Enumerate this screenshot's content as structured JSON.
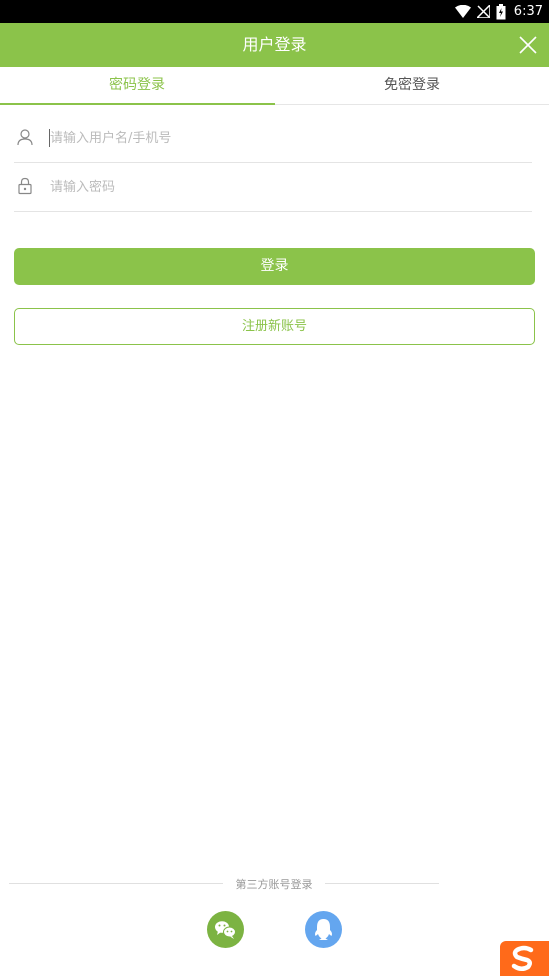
{
  "status_bar": {
    "time": "6:37"
  },
  "header": {
    "title": "用户登录"
  },
  "tabs": [
    {
      "label": "密码登录",
      "active": true
    },
    {
      "label": "免密登录",
      "active": false
    }
  ],
  "form": {
    "username_placeholder": "请输入用户名/手机号",
    "password_placeholder": "请输入密码",
    "login_label": "登录",
    "register_label": "注册新账号"
  },
  "third_party": {
    "label": "第三方账号登录",
    "providers": [
      {
        "icon": "wechat-icon"
      },
      {
        "icon": "qq-icon"
      }
    ]
  },
  "colors": {
    "accent": "#8bc34a",
    "wechat": "#7cb342",
    "qq": "#64a6ef",
    "sogou": "#ff6a1a"
  }
}
